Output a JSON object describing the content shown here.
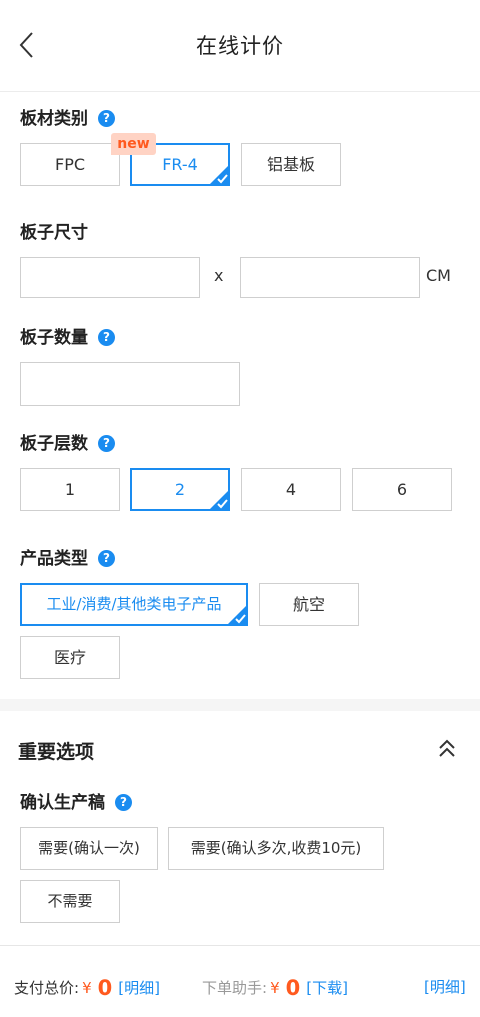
{
  "header": {
    "title": "在线计价",
    "back_icon": "chevron-left-icon"
  },
  "board_material": {
    "label": "板材类别",
    "help": "?",
    "new_badge": "new",
    "options": [
      "FPC",
      "FR-4",
      "铝基板"
    ],
    "selected": "FR-4"
  },
  "board_size": {
    "label": "板子尺寸",
    "width_value": "",
    "height_value": "",
    "separator": "x",
    "unit": "CM"
  },
  "board_quantity": {
    "label": "板子数量",
    "help": "?",
    "value": ""
  },
  "board_layers": {
    "label": "板子层数",
    "help": "?",
    "options": [
      "1",
      "2",
      "4",
      "6"
    ],
    "selected": "2"
  },
  "product_type": {
    "label": "产品类型",
    "help": "?",
    "options": [
      "工业/消费/其他类电子产品",
      "航空",
      "医疗"
    ],
    "selected": "工业/消费/其他类电子产品"
  },
  "important": {
    "title": "重要选项",
    "collapse_icon": "double-chevron-up-icon"
  },
  "confirm_production": {
    "label": "确认生产稿",
    "help": "?",
    "options": [
      "需要(确认一次)",
      "需要(确认多次,收费10元)",
      "不需要"
    ]
  },
  "bottom_bar": {
    "total_label": "支付总价:",
    "total_currency": "¥",
    "total_amount": "0",
    "total_link": "[明细]",
    "helper_label": "下单助手:",
    "helper_currency": "¥",
    "helper_amount": "0",
    "helper_link": "[下载]",
    "detail_link": "[明细]"
  },
  "colors": {
    "accent": "#1a8cf0",
    "price": "#ff5a1f",
    "badge_bg": "#ffd3c4"
  }
}
